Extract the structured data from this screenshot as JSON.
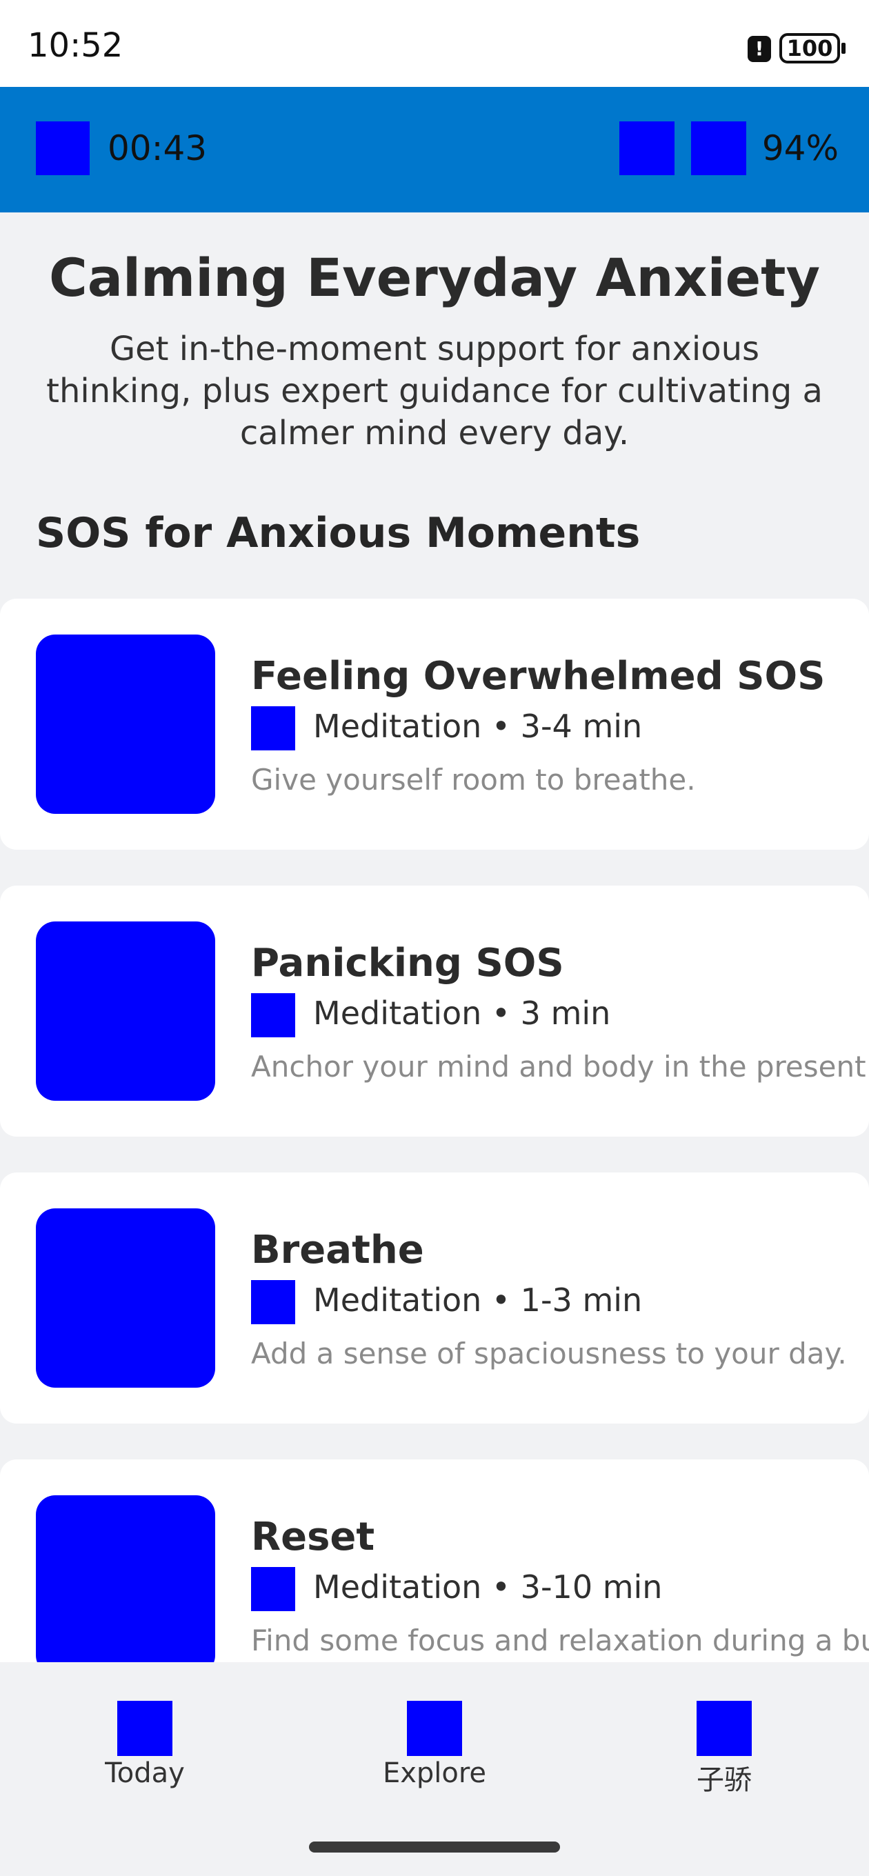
{
  "status_bar": {
    "time": "10:52",
    "alert_glyph": "!",
    "battery": "100"
  },
  "app_bar": {
    "timer": "00:43",
    "percent": "94%"
  },
  "hero": {
    "title": "Calming Everyday Anxiety",
    "subtitle": "Get in-the-moment support for anxious thinking, plus expert guidance for cultivating a calmer mind every day."
  },
  "section": {
    "title": "SOS for Anxious Moments"
  },
  "cards": [
    {
      "title": "Feeling Overwhelmed SOS",
      "meta": "Meditation  •  3-4 min",
      "description": "Give yourself room to breathe."
    },
    {
      "title": "Panicking SOS",
      "meta": "Meditation  •  3 min",
      "description": "Anchor your mind and body in the present."
    },
    {
      "title": "Breathe",
      "meta": "Meditation  •  1-3 min",
      "description": "Add a sense of spaciousness to your day."
    },
    {
      "title": "Reset",
      "meta": "Meditation  •  3-10 min",
      "description": "Find some focus and relaxation during a bu"
    }
  ],
  "bottom_nav": {
    "items": [
      {
        "label": "Today"
      },
      {
        "label": "Explore"
      },
      {
        "label": "子骄"
      }
    ]
  },
  "colors": {
    "app_bar": "#0077cc",
    "placeholder": "#0000ff",
    "background": "#f1f2f4"
  }
}
